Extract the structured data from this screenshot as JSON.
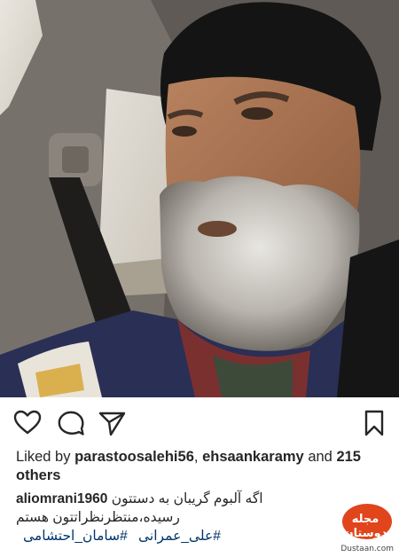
{
  "post": {
    "likes_prefix": "Liked by",
    "liker_1": "parastoosalehi56",
    "separator": ",",
    "liker_2": "ehsaankaramy",
    "and_text": "and",
    "others_count": "215 others",
    "username": "aliomrani1960",
    "caption_line_1": "اگه آلبوم گریبان به دستتون",
    "caption_line_2": "رسیده،منتظرنظراتتون هستم",
    "hashtag_1": "#علی_عمرانی",
    "hashtag_2": "#سامان_احتشامی"
  },
  "actions": {
    "like_icon": "heart-outline-icon",
    "comment_icon": "comment-bubble-icon",
    "share_icon": "paper-plane-icon",
    "save_icon": "bookmark-icon"
  },
  "watermark": {
    "logo_text": "مجله دوستان",
    "site": "Dustaan.com"
  },
  "colors": {
    "text": "#262626",
    "hashtag": "#003569",
    "watermark": "#e0451c"
  }
}
